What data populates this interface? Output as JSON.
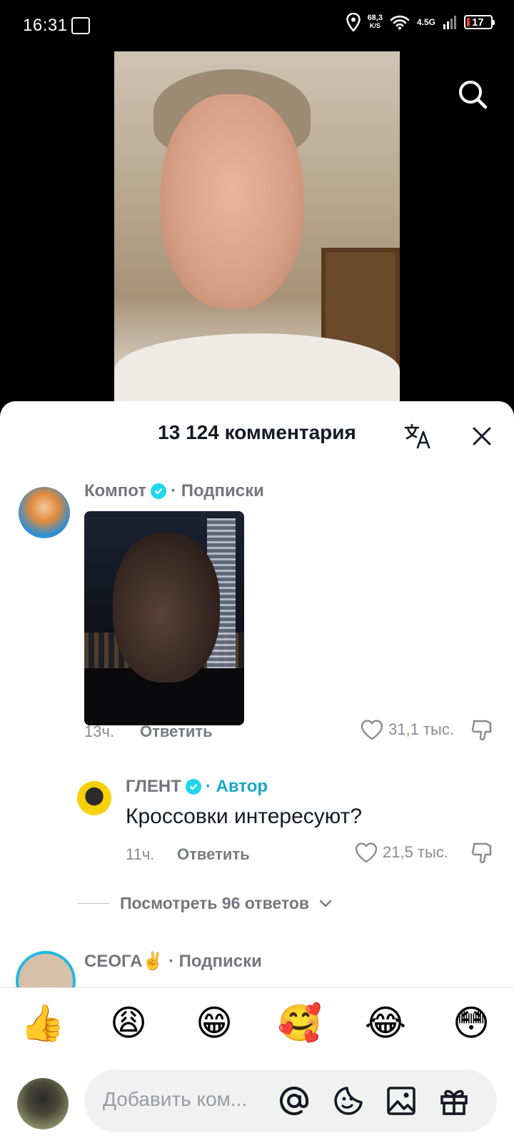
{
  "status_bar": {
    "time": "16:31",
    "net_speed_value": "68,3",
    "net_speed_unit": "K/S",
    "network": "4.5G",
    "battery": "17",
    "battery_color": "#ff3b30"
  },
  "sheet": {
    "title": "13 124 комментария"
  },
  "comments": [
    {
      "author": "Компот",
      "verified": true,
      "tag": "· Подписки",
      "time": "13ч.",
      "reply_label": "Ответить",
      "likes": "31,1 тыс.",
      "has_image": true
    },
    {
      "author": "ГЛЕНТ",
      "verified": true,
      "tag": "· Автор",
      "text": "Кроссовки интересуют?",
      "time": "11ч.",
      "reply_label": "Ответить",
      "likes": "21,5 тыс."
    },
    {
      "author": "СЕОГА✌️",
      "tag": "· Подписки"
    }
  ],
  "view_replies": "Посмотреть 96 ответов",
  "reactions": [
    "👍",
    "😩",
    "😁",
    "🥰",
    "😂",
    "😳"
  ],
  "input": {
    "placeholder": "Добавить ком..."
  },
  "colors": {
    "accent_verified": "#20d5ec",
    "author_tag": "#18a7c6",
    "story_ring": "#20b8e6"
  }
}
